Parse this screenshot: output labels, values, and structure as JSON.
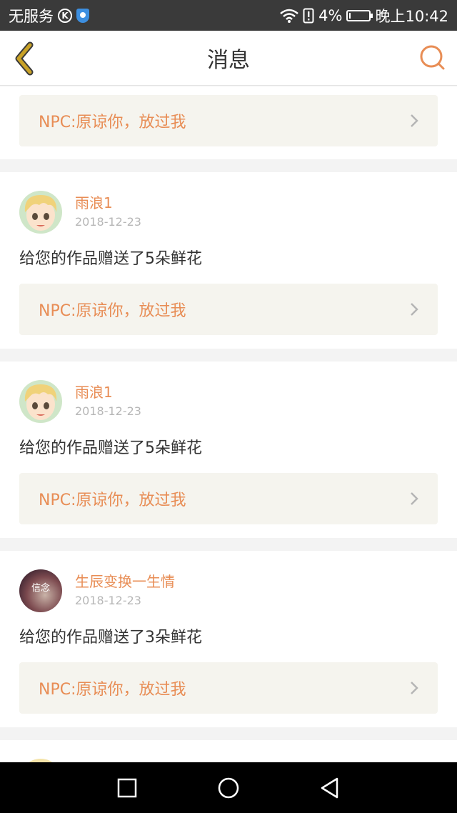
{
  "status_bar": {
    "carrier": "无服务",
    "k_icon": "K",
    "battery_percent": "4%",
    "battery_level": 0.04,
    "time": "晚上10:42"
  },
  "nav": {
    "title": "消息"
  },
  "feed": {
    "top_reference": "NPC:原谅你，放过我",
    "items": [
      {
        "username": "雨浪1",
        "date": "2018-12-23",
        "message": "给您的作品赠送了5朵鲜花",
        "reference": "NPC:原谅你，放过我",
        "avatar": "cartoon-boy-avatar"
      },
      {
        "username": "雨浪1",
        "date": "2018-12-23",
        "message": "给您的作品赠送了5朵鲜花",
        "reference": "NPC:原谅你，放过我",
        "avatar": "cartoon-boy-avatar"
      },
      {
        "username": "生辰变换一生情",
        "date": "2018-12-23",
        "message": "给您的作品赠送了3朵鲜花",
        "reference": "NPC:原谅你，放过我",
        "avatar": "信念",
        "avatar_icon": "xinnian-photo-avatar"
      }
    ]
  },
  "colors": {
    "accent": "#e88d55",
    "back_arrow": "#c9a227",
    "reference_bg": "#f5f4ee"
  }
}
